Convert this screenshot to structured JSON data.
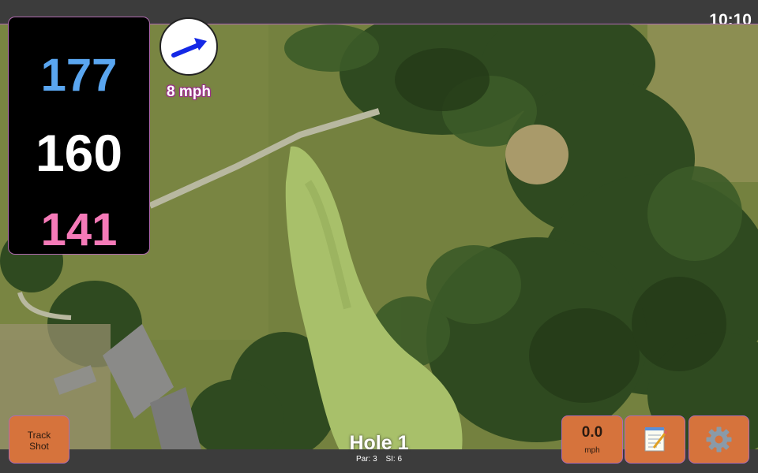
{
  "status_bar": {
    "time": "10:10"
  },
  "yardages": {
    "back": "177",
    "middle": "160",
    "front": "141"
  },
  "wind": {
    "speed": "8 mph",
    "icon": "wind-arrow-icon"
  },
  "buttons": {
    "track_shot": {
      "line1": "Track",
      "line2": "Shot"
    },
    "speed": {
      "value": "0.0",
      "unit": "mph"
    },
    "notes": {
      "icon": "notepad-icon"
    },
    "settings": {
      "icon": "gear-icon"
    }
  },
  "hole": {
    "title": "Hole 1",
    "par": "Par: 3",
    "si": "SI: 6"
  },
  "colors": {
    "back_yardage": "#5aa6f0",
    "middle_yardage": "#ffffff",
    "front_yardage": "#f57ab8",
    "button": "#d6733c",
    "wind_arrow": "#1428e6"
  }
}
